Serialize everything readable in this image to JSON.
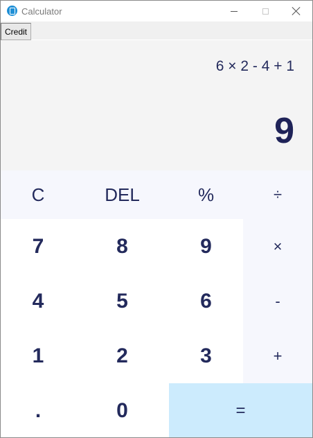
{
  "window": {
    "title": "Calculator"
  },
  "menu": {
    "credit_label": "Credit"
  },
  "display": {
    "expression": "6 × 2 - 4 + 1",
    "result": "9"
  },
  "keys": {
    "clear": "C",
    "delete": "DEL",
    "percent": "%",
    "divide": "÷",
    "seven": "7",
    "eight": "8",
    "nine": "9",
    "multiply": "×",
    "four": "4",
    "five": "5",
    "six": "6",
    "subtract": "-",
    "one": "1",
    "two": "2",
    "three": "3",
    "add": "+",
    "decimal": ".",
    "zero": "0",
    "equals": "="
  },
  "colors": {
    "text": "#232a5c",
    "operator_bg": "#f6f7fd",
    "equals_bg": "#ccebfd",
    "display_bg": "#f4f4f4",
    "app_icon": "#1e8fd6"
  }
}
